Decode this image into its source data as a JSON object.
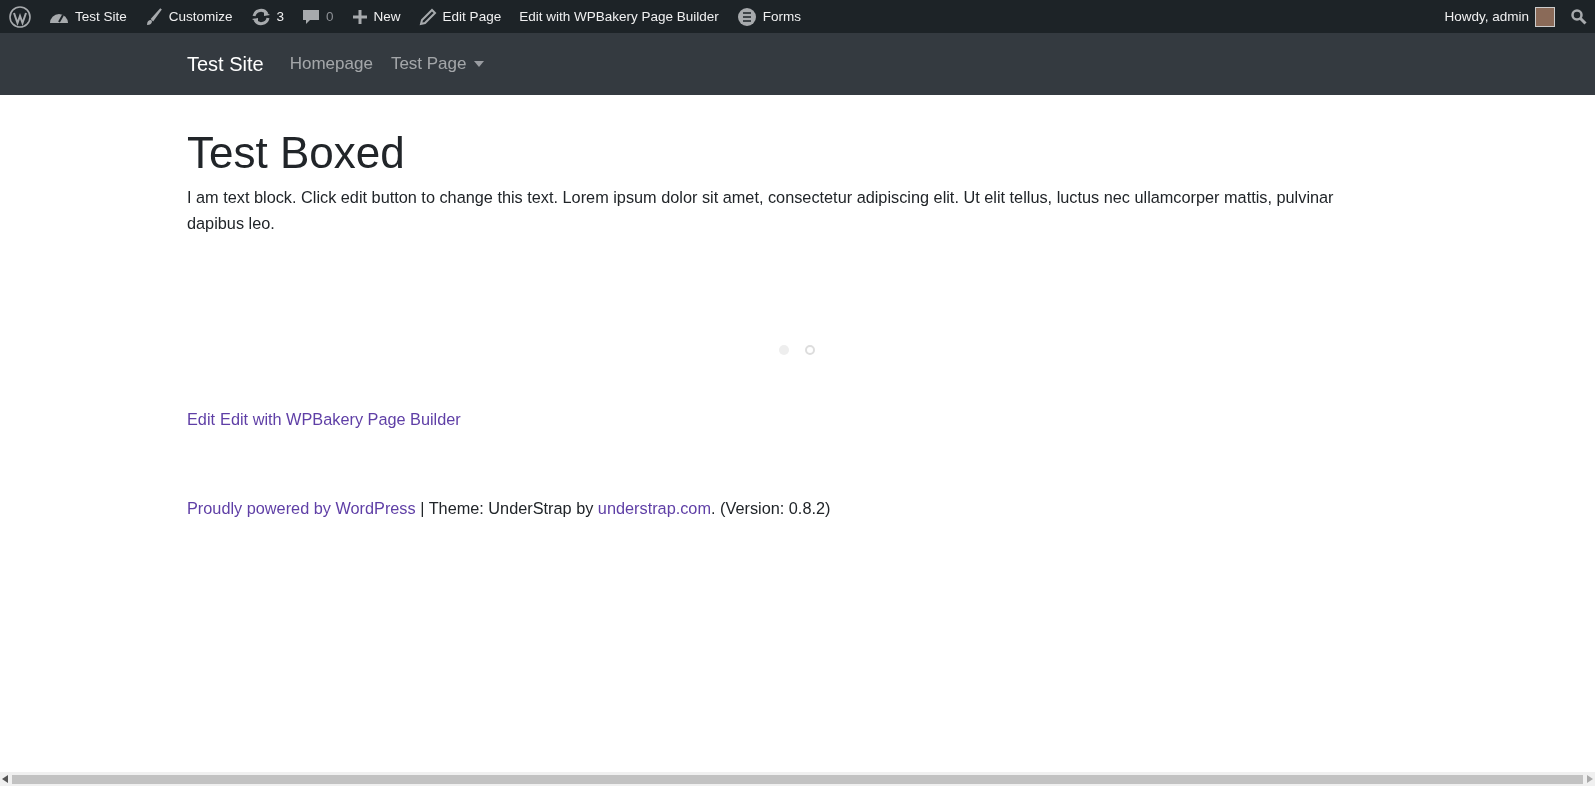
{
  "admin_bar": {
    "left": [
      {
        "kind": "logo"
      },
      {
        "kind": "dashboard",
        "label": "Test Site"
      },
      {
        "kind": "brush",
        "label": "Customize"
      },
      {
        "kind": "updates",
        "label": "3"
      },
      {
        "kind": "comments",
        "label": "0"
      },
      {
        "kind": "plus",
        "label": "New"
      },
      {
        "kind": "pencil",
        "label": "Edit Page"
      },
      {
        "kind": "plain",
        "label": "Edit with WPBakery Page Builder"
      },
      {
        "kind": "forms",
        "label": "Forms"
      }
    ],
    "greeting": "Howdy, admin"
  },
  "navbar": {
    "brand": "Test Site",
    "items": [
      {
        "label": "Homepage",
        "dropdown": false
      },
      {
        "label": "Test Page",
        "dropdown": true
      }
    ]
  },
  "page": {
    "title": "Test Boxed",
    "text": "I am text block. Click edit button to change this text. Lorem ipsum dolor sit amet, consectetur adipiscing elit. Ut elit tellus, luctus nec ullamcorper mattis, pulvinar dapibus leo.",
    "edit_links": [
      "Edit",
      "Edit with WPBakery Page Builder"
    ]
  },
  "footer": [
    {
      "kind": "link",
      "text": "Proudly powered by WordPress"
    },
    {
      "kind": "text",
      "text": " | Theme: UnderStrap by "
    },
    {
      "kind": "link",
      "text": "understrap.com"
    },
    {
      "kind": "text",
      "text": ". (Version: 0.8.2)"
    }
  ]
}
